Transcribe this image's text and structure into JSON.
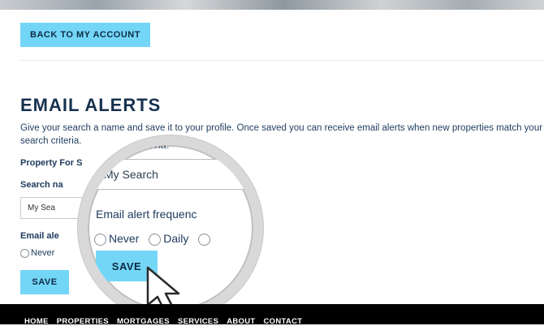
{
  "header": {
    "back_label": "BACK TO MY ACCOUNT"
  },
  "page": {
    "title": "EMAIL ALERTS",
    "description": "Give your search a name and save it to your profile. Once saved you can receive email alerts when new properties match your search criteria."
  },
  "form": {
    "property_for_label": "Property For S",
    "search_name_label": "Search na",
    "search_name_value": "My Sea",
    "email_alert_label": "Email ale",
    "radio_never": "Never",
    "save_label": "SAVE"
  },
  "magnifier": {
    "hint_text": "ren na.",
    "search_value": "My Search",
    "frequency_label": "Email alert frequenc",
    "options": [
      "Never",
      "Daily"
    ],
    "save_label": "SAVE"
  },
  "footer": {
    "nav": [
      "HOME",
      "PROPERTIES",
      "MORTGAGES",
      "SERVICES",
      "ABOUT",
      "CONTACT"
    ]
  },
  "colors": {
    "accent": "#74d6f7",
    "text": "#1d3a5c",
    "footer": "#000000"
  }
}
